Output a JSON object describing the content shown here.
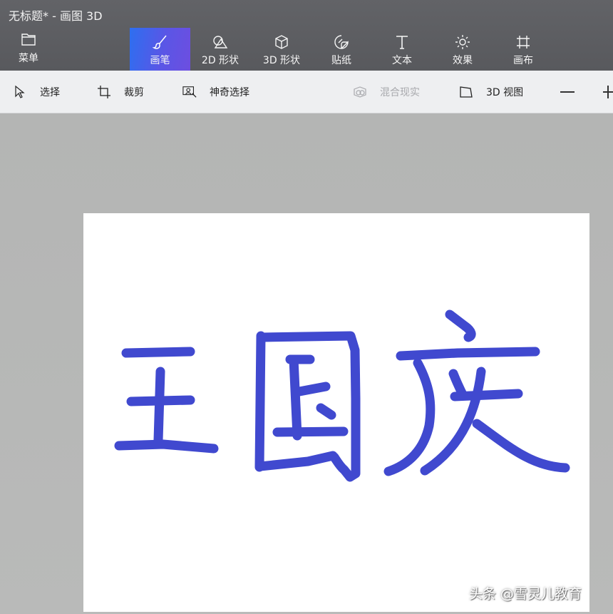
{
  "window": {
    "title": "无标题* - 画图 3D"
  },
  "menu": {
    "label": "菜单",
    "icon": "folder-icon"
  },
  "ribbon": {
    "tools": [
      {
        "label": "画笔",
        "icon": "brush-icon",
        "active": true
      },
      {
        "label": "2D 形状",
        "icon": "shapes-2d-icon"
      },
      {
        "label": "3D 形状",
        "icon": "cube-icon"
      },
      {
        "label": "贴纸",
        "icon": "sticker-icon"
      },
      {
        "label": "文本",
        "icon": "text-icon"
      },
      {
        "label": "效果",
        "icon": "sun-icon"
      },
      {
        "label": "画布",
        "icon": "canvas-icon"
      }
    ],
    "accent_color": "#4f5fe8"
  },
  "toolbar": {
    "select_label": "选择",
    "crop_label": "裁剪",
    "magic_select_label": "神奇选择",
    "mixed_reality_label": "混合现实",
    "view3d_label": "3D 视图"
  },
  "canvas": {
    "stroke_color": "#4049cf",
    "background": "#ffffff"
  },
  "watermark": {
    "text": "头条 @雪灵儿教育"
  }
}
